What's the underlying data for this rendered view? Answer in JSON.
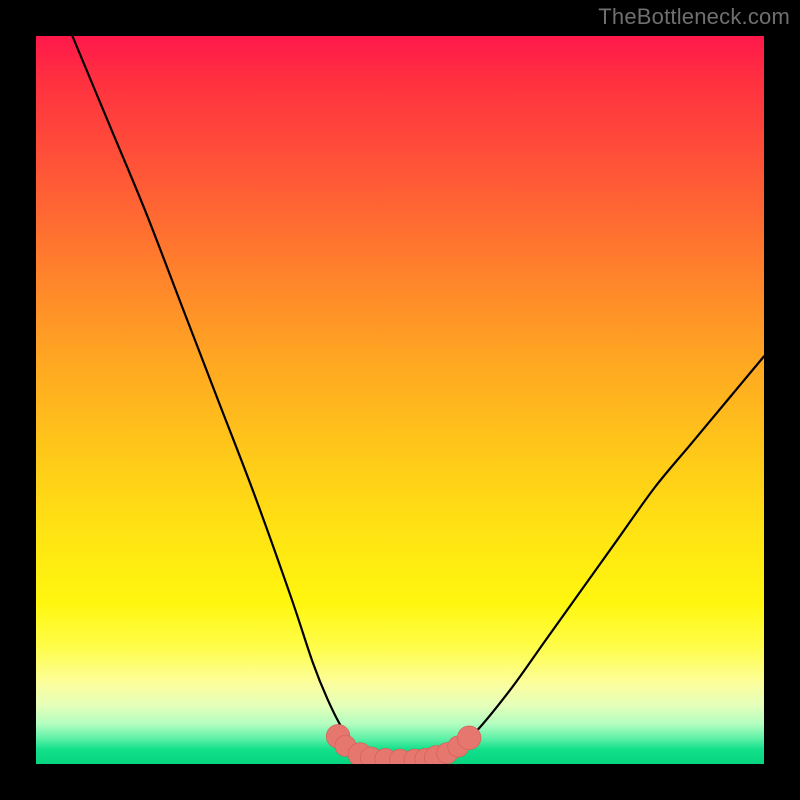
{
  "watermark": "TheBottleneck.com",
  "colors": {
    "frame": "#000000",
    "curve_stroke": "#000000",
    "marker_fill": "#e6776e",
    "marker_stroke": "#d35c55",
    "gradient_top": "#ff184b",
    "gradient_bottom": "#07d47e"
  },
  "chart_data": {
    "type": "line",
    "title": "",
    "xlabel": "",
    "ylabel": "",
    "xlim": [
      0,
      100
    ],
    "ylim": [
      0,
      100
    ],
    "grid": false,
    "legend": false,
    "series": [
      {
        "name": "bottleneck-curve",
        "x": [
          5,
          10,
          15,
          20,
          25,
          30,
          35,
          38,
          40,
          42,
          44,
          46,
          48,
          50,
          52,
          54,
          56,
          60,
          65,
          70,
          75,
          80,
          85,
          90,
          95,
          100
        ],
        "y": [
          100,
          88,
          76,
          63,
          50,
          37,
          23,
          14,
          9,
          5,
          2.3,
          1.2,
          0.8,
          0.6,
          0.6,
          0.8,
          1.2,
          4,
          10,
          17,
          24,
          31,
          38,
          44,
          50,
          56
        ]
      }
    ],
    "markers": [
      {
        "x": 41.5,
        "y": 3.8,
        "r": 1.2
      },
      {
        "x": 42.5,
        "y": 2.5,
        "r": 1.0
      },
      {
        "x": 44.5,
        "y": 1.3,
        "r": 1.2
      },
      {
        "x": 46.0,
        "y": 0.9,
        "r": 1.0
      },
      {
        "x": 48.0,
        "y": 0.7,
        "r": 1.0
      },
      {
        "x": 50.0,
        "y": 0.6,
        "r": 1.0
      },
      {
        "x": 52.0,
        "y": 0.6,
        "r": 1.0
      },
      {
        "x": 53.5,
        "y": 0.7,
        "r": 1.0
      },
      {
        "x": 55.0,
        "y": 0.9,
        "r": 1.2
      },
      {
        "x": 56.5,
        "y": 1.5,
        "r": 1.0
      },
      {
        "x": 58.0,
        "y": 2.4,
        "r": 1.0
      },
      {
        "x": 59.5,
        "y": 3.6,
        "r": 1.2
      }
    ]
  }
}
